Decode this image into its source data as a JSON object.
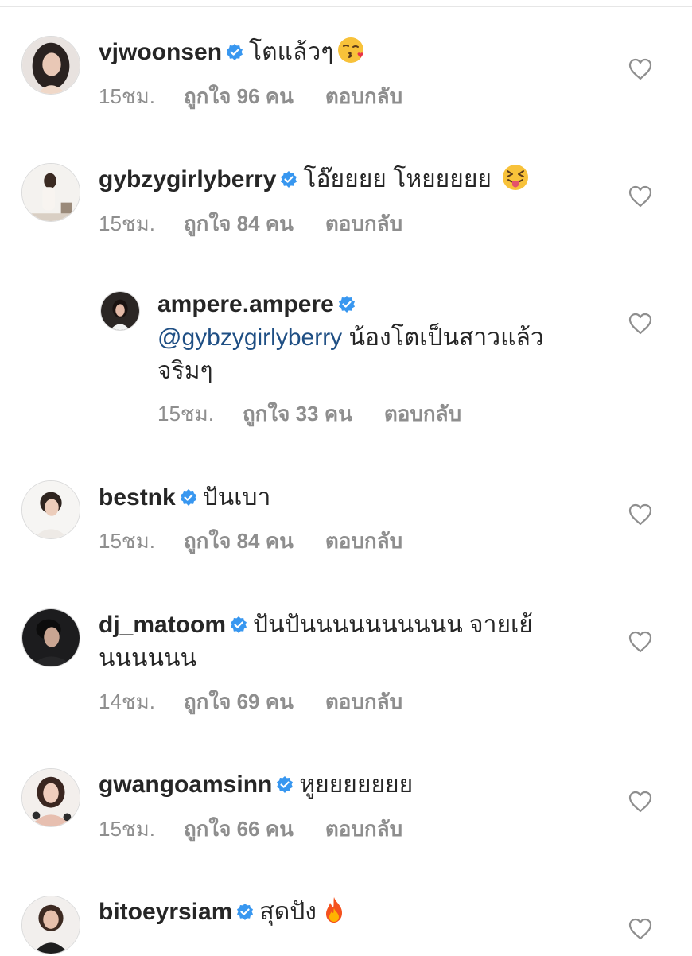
{
  "comments": [
    {
      "username": "vjwoonsen",
      "text": "โตแล้วๆ",
      "emoji": "kissing-wink-emoji",
      "time": "15ชม.",
      "likes": "ถูกใจ 96 คน",
      "reply": "ตอบกลับ"
    },
    {
      "username": "gybzygirlyberry",
      "text": "โอ๊ยยยย โหยยยยย",
      "emoji": "tongue-squint-emoji",
      "time": "15ชม.",
      "likes": "ถูกใจ 84 คน",
      "reply": "ตอบกลับ"
    },
    {
      "username": "ampere.ampere",
      "mention": "@gybzygirlyberry",
      "text": "น้องโตเป็นสาวแล้ว",
      "text_line2": "จริมๆ",
      "time": "15ชม.",
      "likes": "ถูกใจ 33 คน",
      "reply": "ตอบกลับ"
    },
    {
      "username": "bestnk",
      "text": "ปันเบา",
      "time": "15ชม.",
      "likes": "ถูกใจ 84 คน",
      "reply": "ตอบกลับ"
    },
    {
      "username": "dj_matoom",
      "text": "ปันปันนนนนนนนนน จายเย้",
      "text_line2": "นนนนนน",
      "time": "14ชม.",
      "likes": "ถูกใจ 69 คน",
      "reply": "ตอบกลับ"
    },
    {
      "username": "gwangoamsinn",
      "text": "หูยยยยยยย",
      "time": "15ชม.",
      "likes": "ถูกใจ 66 คน",
      "reply": "ตอบกลับ"
    },
    {
      "username": "bitoeyrsiam",
      "text": "สุดปัง",
      "emoji": "fire-emoji"
    }
  ],
  "colors": {
    "text": "#262626",
    "meta": "#8e8e8e",
    "mention": "#1f4f84",
    "verified": "#3897f0",
    "divider": "#e6e6e6"
  }
}
